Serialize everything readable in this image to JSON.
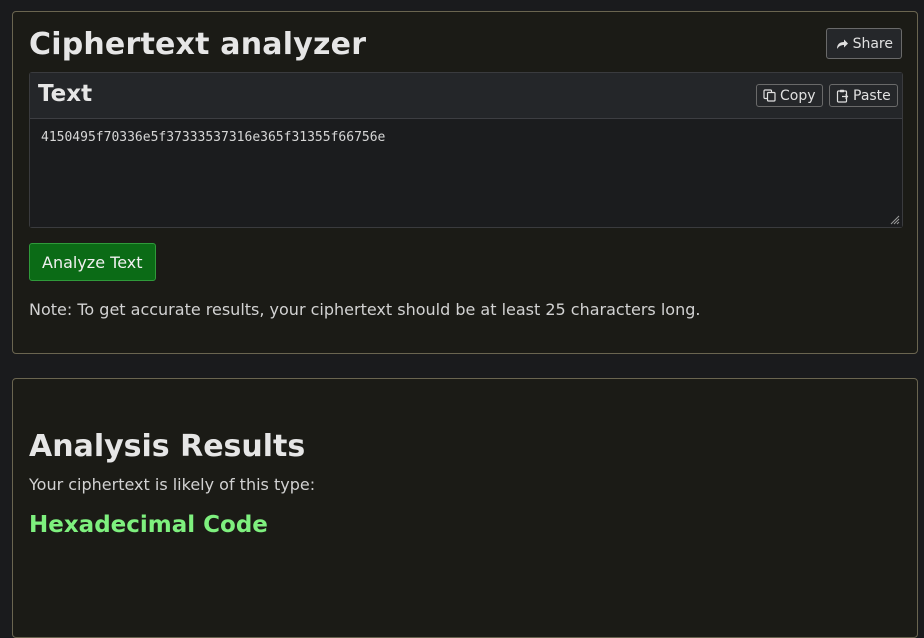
{
  "header": {
    "title": "Ciphertext analyzer",
    "share_label": "Share"
  },
  "text_card": {
    "title": "Text",
    "copy_label": "Copy",
    "paste_label": "Paste",
    "input_value": "4150495f70336e5f37333537316e365f31355f66756e"
  },
  "analyze": {
    "button_label": "Analyze Text",
    "note": "Note: To get accurate results, your ciphertext should be at least 25 characters long."
  },
  "results": {
    "title": "Analysis Results",
    "subtitle": "Your ciphertext is likely of this type:",
    "type": "Hexadecimal Code",
    "type_color": "#7ef07e"
  },
  "icons": {
    "share": "share-arrow-icon",
    "copy": "copy-icon",
    "paste": "paste-clipboard-icon",
    "resize": "resize-grip-icon"
  },
  "colors": {
    "accent_button": "#0b6b16",
    "panel_border": "#6a6550"
  }
}
